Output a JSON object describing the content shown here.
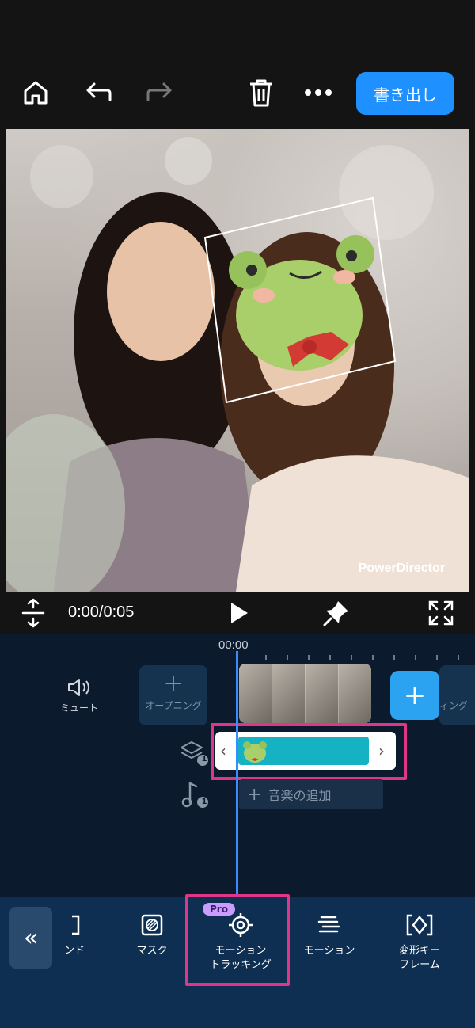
{
  "header": {
    "home_icon": "home-icon",
    "undo_icon": "undo-icon",
    "redo_icon": "redo-icon",
    "delete_icon": "trash-icon",
    "more_icon": "more-icon",
    "export_label": "書き出し",
    "accent": "#1e90ff"
  },
  "preview": {
    "watermark": "PowerDirector"
  },
  "playback": {
    "timecode": "0:00/0:05"
  },
  "timeline": {
    "ruler_start": "00:00",
    "mute_label": "ミュート",
    "opening_label": "オープニング",
    "ending_label": "ィング",
    "overlay_badge": "1",
    "music_badge": "1",
    "music_add_label": "音楽の追加",
    "highlight_color": "#e0368a"
  },
  "toolbar": {
    "partial_label": "ンド",
    "mask_label": "マスク",
    "pro_badge": "Pro",
    "motion_tracking_label_1": "モーション",
    "motion_tracking_label_2": "トラッキング",
    "motion_label": "モーション",
    "keyframe_label_1": "変形キー",
    "keyframe_label_2": "フレーム"
  }
}
